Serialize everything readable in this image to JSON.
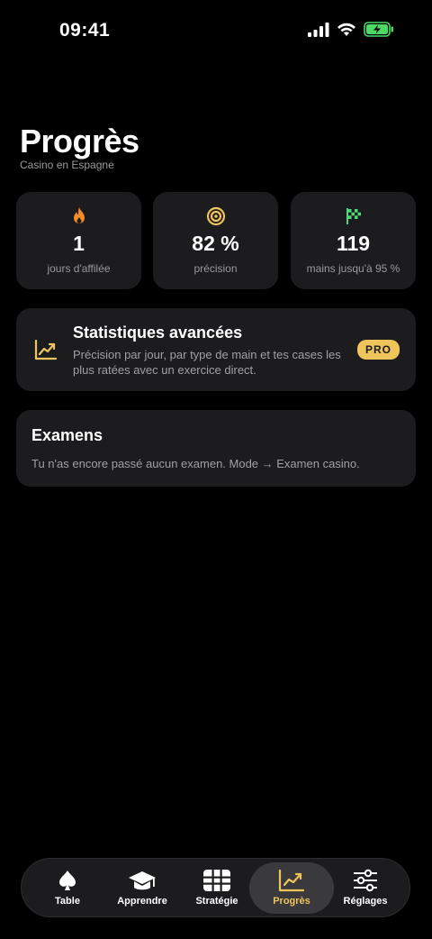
{
  "status_bar": {
    "time": "09:41"
  },
  "header": {
    "title": "Progrès",
    "subtitle": "Casino en Espagne"
  },
  "stats": [
    {
      "icon": "flame-icon",
      "value": "1",
      "label": "jours d'affilée",
      "color": "#f28c28"
    },
    {
      "icon": "target-icon",
      "value": "82 %",
      "label": "précision",
      "color": "#efc45a"
    },
    {
      "icon": "checkered-flag-icon",
      "value": "119",
      "label": "mains jusqu'à 95 %",
      "color": "#4cd97b"
    }
  ],
  "advanced": {
    "icon": "trend-chart-icon",
    "title": "Statistiques avancées",
    "description": "Précision par jour, par type de main et tes cases les plus ratées avec un exercice direct.",
    "badge": "PRO"
  },
  "exams": {
    "title": "Examens",
    "text": "Tu n'as encore passé aucun examen. Mode → Examen casino."
  },
  "tabs": [
    {
      "label": "Table",
      "icon": "spade-icon"
    },
    {
      "label": "Apprendre",
      "icon": "graduation-cap-icon"
    },
    {
      "label": "Stratégie",
      "icon": "grid-icon"
    },
    {
      "label": "Progrès",
      "icon": "trend-chart-icon",
      "active": true
    },
    {
      "label": "Réglages",
      "icon": "sliders-icon"
    }
  ],
  "colors": {
    "accent": "#efc45a",
    "card": "#1c1c1e",
    "background": "#000000"
  }
}
